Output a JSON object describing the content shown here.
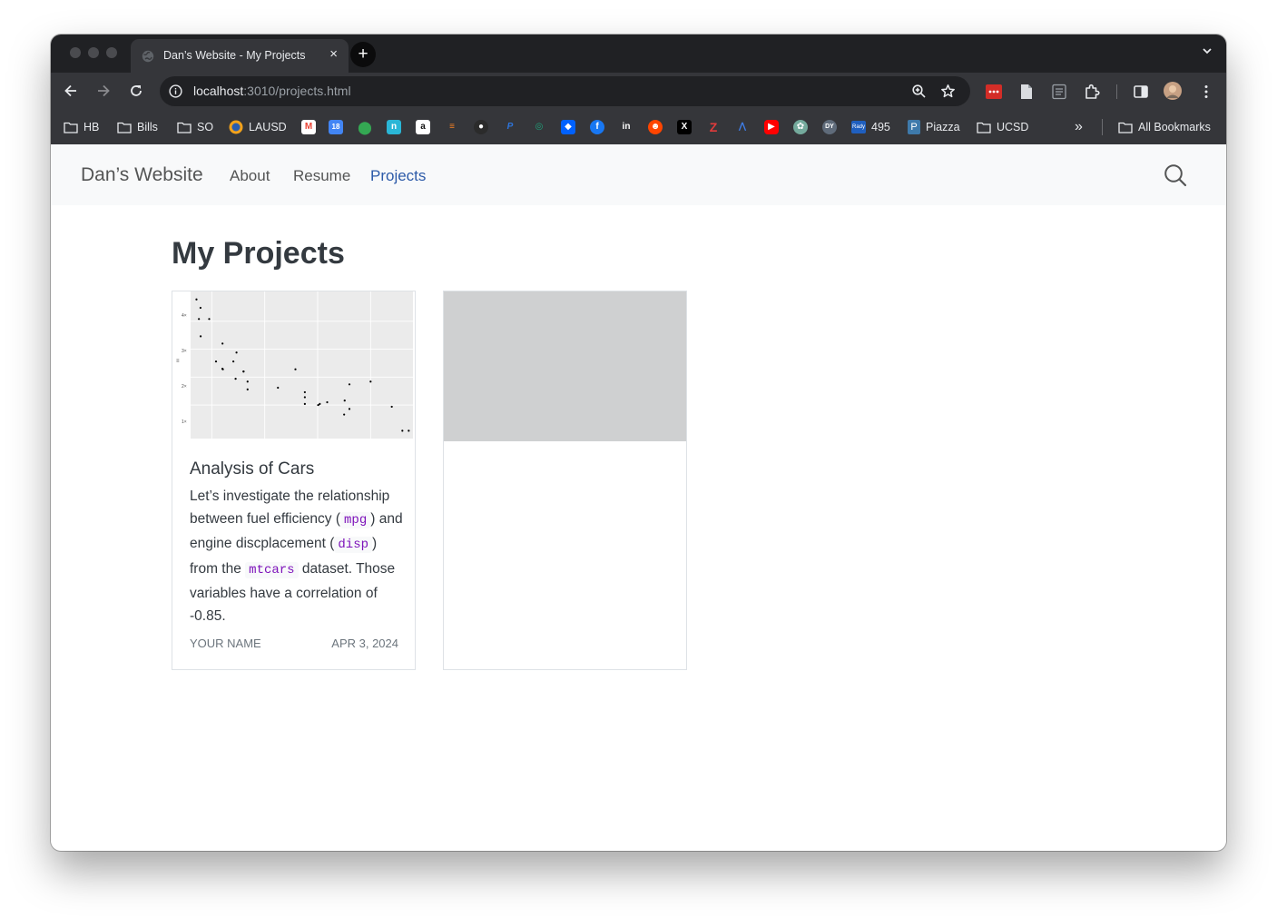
{
  "browser": {
    "tab_title": "Dan’s Website - My Projects",
    "tab_close": "×",
    "new_tab": "+",
    "url_host": "localhost",
    "url_rest": ":3010/projects.html",
    "icons": [
      "back-icon",
      "forward-icon",
      "reload-icon",
      "info-icon",
      "zoom-icon",
      "star-icon",
      "extensions-icon",
      "side-panel-icon",
      "more-icon"
    ]
  },
  "bookmarks": {
    "items": [
      {
        "label": "HB",
        "icon": "folder-icon"
      },
      {
        "label": "Bills",
        "icon": "folder-icon"
      },
      {
        "label": "SO",
        "icon": "folder-icon"
      },
      {
        "label": "LAUSD",
        "icon": "lausd-icon"
      },
      {
        "label": "495",
        "icon": "rady-icon"
      },
      {
        "label": "Piazza",
        "icon": "piazza-icon"
      },
      {
        "label": "UCSD",
        "icon": "folder-icon"
      }
    ],
    "more": "»",
    "all_bookmarks": "All Bookmarks"
  },
  "site": {
    "brand": "Dan’s Website",
    "nav": [
      {
        "label": "About",
        "active": false
      },
      {
        "label": "Resume",
        "active": false
      },
      {
        "label": "Projects",
        "active": true
      }
    ]
  },
  "page": {
    "title": "My Projects",
    "cards": [
      {
        "title": "Analysis of Cars",
        "desc": {
          "t1": "Let’s investigate the relationship between fuel efficiency (",
          "c1": "mpg",
          "t2": ") and engine discplacement (",
          "c2": "disp",
          "t3": ") from the ",
          "c3": "mtcars",
          "t4": " dataset. Those variables have a correlation of -0.85."
        },
        "author": "Your Name",
        "date": "Apr 3, 2024",
        "has_image": true
      },
      {
        "title": "",
        "has_image": false
      }
    ]
  },
  "chart_data": {
    "type": "scatter",
    "x": [
      71.1,
      75.7,
      78.7,
      79.0,
      95.1,
      108.0,
      120.1,
      120.3,
      121.0,
      140.8,
      145.0,
      146.7,
      160.0,
      160.0,
      167.6,
      167.6,
      225.0,
      258.0,
      275.8,
      275.8,
      275.8,
      301.0,
      304.0,
      318.0,
      350.0,
      351.0,
      360.0,
      360.0,
      400.0,
      440.0,
      460.0,
      472.0
    ],
    "y": [
      33.9,
      30.4,
      32.4,
      27.3,
      30.4,
      22.8,
      21.5,
      26.0,
      21.4,
      22.8,
      19.7,
      24.4,
      21.0,
      21.0,
      19.2,
      17.8,
      18.1,
      21.4,
      16.4,
      17.3,
      15.2,
      15.0,
      15.2,
      15.5,
      13.3,
      15.8,
      18.7,
      14.3,
      19.2,
      14.7,
      10.4,
      10.4
    ],
    "xlim": [
      60,
      480
    ],
    "ylim": [
      9,
      35
    ],
    "grid": true,
    "title": "",
    "xlabel": "",
    "ylabel": ""
  }
}
